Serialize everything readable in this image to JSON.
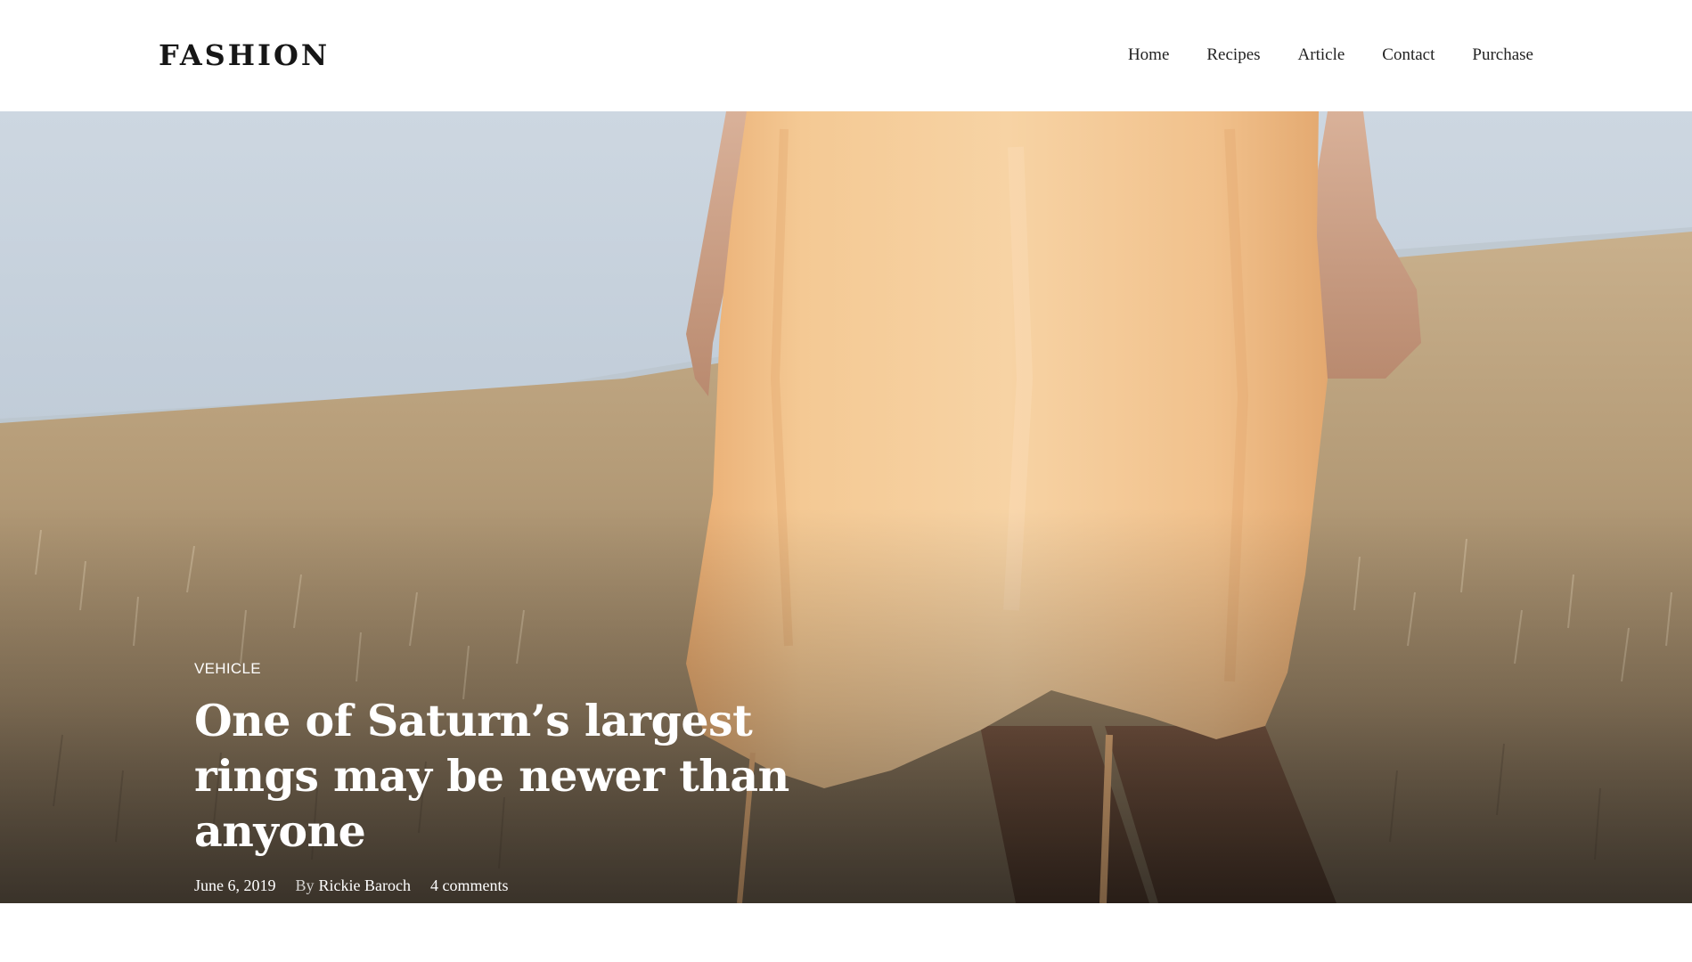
{
  "header": {
    "logo": "FASHION",
    "nav": [
      {
        "label": "Home"
      },
      {
        "label": "Recipes"
      },
      {
        "label": "Article"
      },
      {
        "label": "Contact"
      },
      {
        "label": "Purchase"
      }
    ]
  },
  "hero": {
    "image_subject": "woman-in-peach-dress-in-wheat-field",
    "category": "Vehicle",
    "title": "One of Saturn’s largest rings may be newer than anyone",
    "date": "June 6, 2019",
    "by_prefix": "By",
    "author": "Rickie Baroch",
    "comments": "4 comments"
  },
  "colors": {
    "background": "#ffffff",
    "text": "#1e1e1e",
    "hero_text": "#ffffff",
    "sky": "#c8d2dc",
    "field": "#b9a27f",
    "dress": "#f2c48f"
  }
}
